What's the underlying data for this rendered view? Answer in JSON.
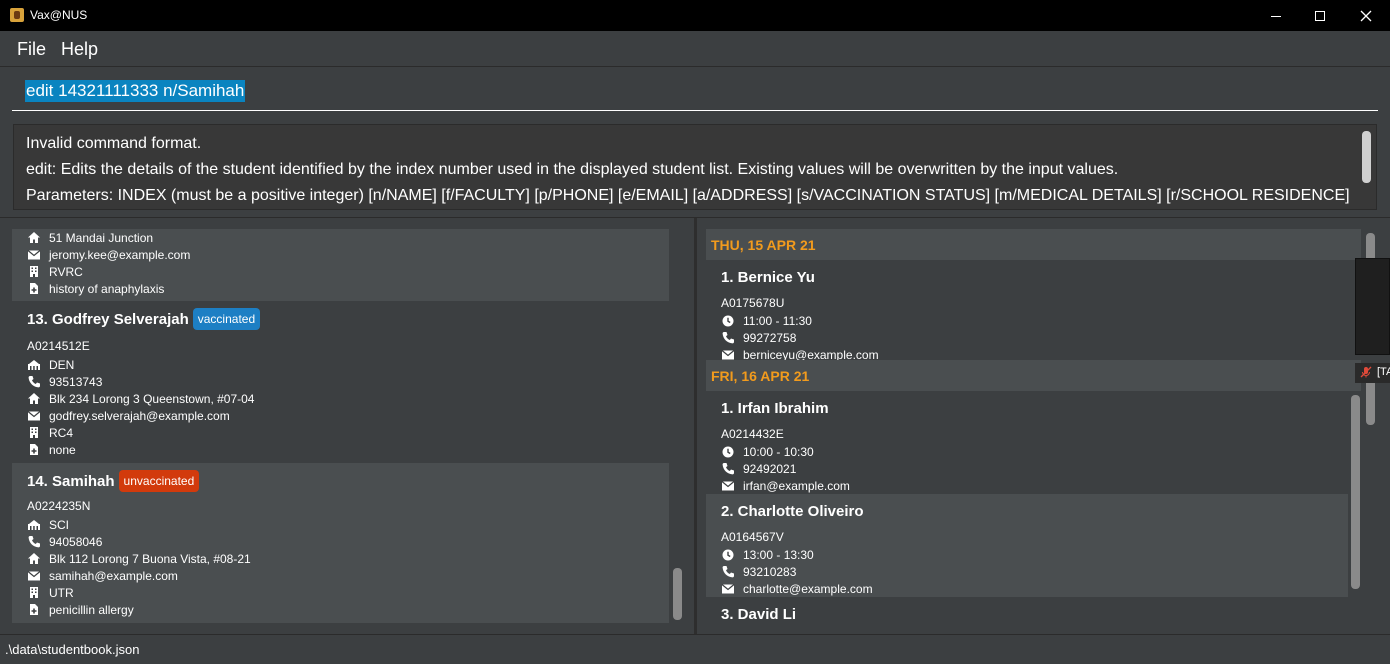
{
  "window": {
    "title": "Vax@NUS"
  },
  "menu": {
    "file": "File",
    "help": "Help"
  },
  "command": {
    "value": "edit 14321111333 n/Samihah"
  },
  "result": {
    "lines": [
      "Invalid command format.",
      "edit: Edits the details of the student identified by the index number used in the displayed student list. Existing values will be overwritten by the input values.",
      "Parameters: INDEX (must be a positive integer) [n/NAME] [f/FACULTY] [p/PHONE] [e/EMAIL] [a/ADDRESS] [s/VACCINATION STATUS] [m/MEDICAL DETAILS] [r/SCHOOL RESIDENCE]"
    ]
  },
  "students": {
    "partial": {
      "address": "51 Mandai Junction",
      "email": "jeromy.kee@example.com",
      "residence": "RVRC",
      "medical": "history of anaphylaxis"
    },
    "s13": {
      "index_name": "13.  Godfrey Selverajah",
      "status": "vaccinated",
      "matric": "A0214512E",
      "faculty": "DEN",
      "phone": "93513743",
      "address": "Blk 234 Lorong 3 Queenstown, #07-04",
      "email": "godfrey.selverajah@example.com",
      "residence": "RC4",
      "medical": "none"
    },
    "s14": {
      "index_name": "14.  Samihah",
      "status": "unvaccinated",
      "matric": "A0224235N",
      "faculty": "SCI",
      "phone": "94058046",
      "address": "Blk 112 Lorong 7 Buona Vista, #08-21",
      "email": "samihah@example.com",
      "residence": "UTR",
      "medical": "penicillin allergy"
    }
  },
  "appointments": {
    "day1": {
      "date": "THU, 15 APR 21",
      "a1": {
        "index_name": "1.  Bernice Yu",
        "matric": "A0175678U",
        "time": "11:00 - 11:30",
        "phone": "99272758",
        "email": "berniceyu@example.com"
      }
    },
    "day2": {
      "date": "FRI, 16 APR 21",
      "a1": {
        "index_name": "1.  Irfan Ibrahim",
        "matric": "A0214432E",
        "time": "10:00 - 10:30",
        "phone": "92492021",
        "email": "irfan@example.com"
      },
      "a2": {
        "index_name": "2.  Charlotte Oliveiro",
        "matric": "A0164567V",
        "time": "13:00 - 13:30",
        "phone": "93210283",
        "email": "charlotte@example.com"
      },
      "a3": {
        "index_name": "3.  David Li"
      }
    }
  },
  "overlay": {
    "text": "[TA"
  },
  "status": {
    "path": ".\\data\\studentbook.json"
  },
  "colors": {
    "accent_date": "#f29b1d",
    "vaccinated": "#1d7fc4",
    "unvaccinated": "#d23a0c",
    "selection": "#0a84c0"
  }
}
